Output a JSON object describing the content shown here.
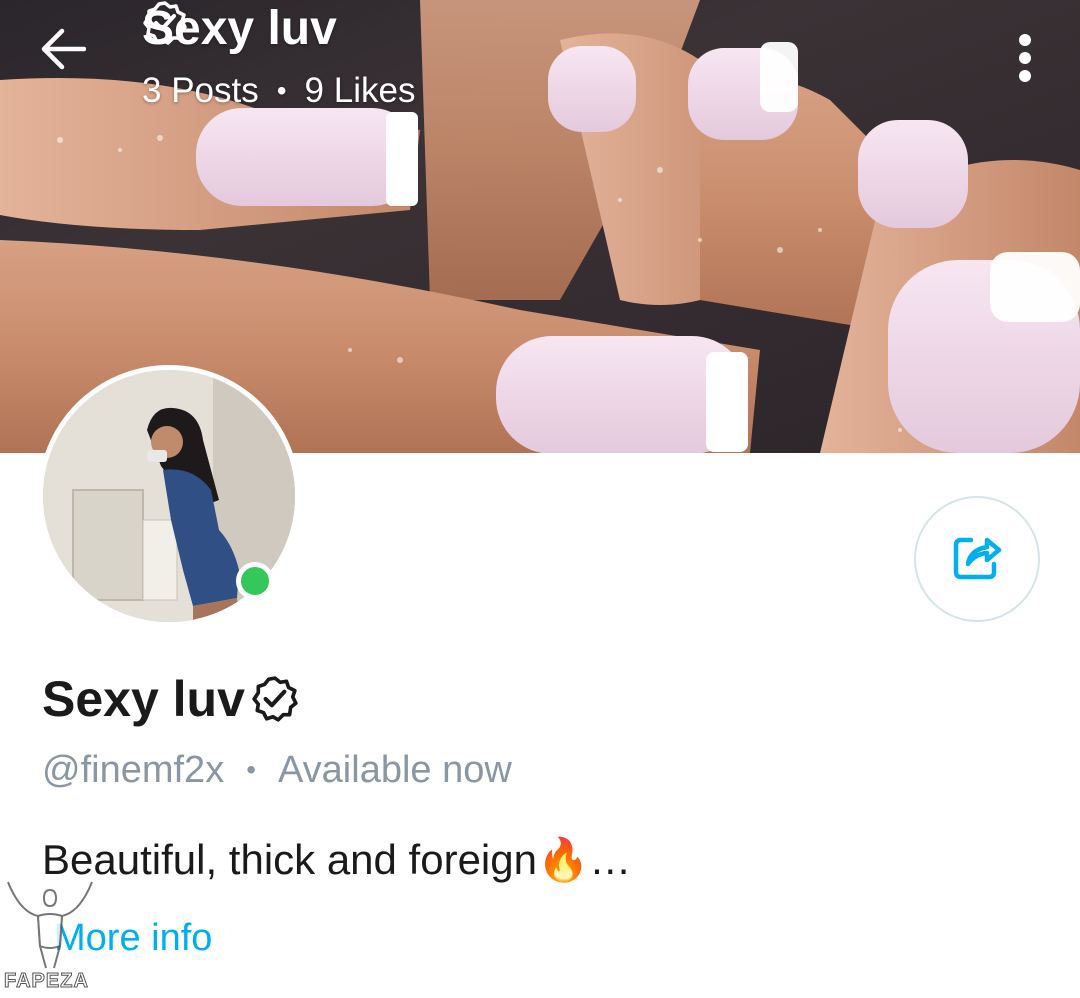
{
  "header": {
    "title": "Sexy luv",
    "posts": "3 Posts",
    "separator": "•",
    "likes": "9 Likes"
  },
  "icons": {
    "back": "arrow-left-icon",
    "more": "more-vertical-icon",
    "verified": "verified-badge-icon",
    "share": "share-icon"
  },
  "profile": {
    "name": "Sexy luv",
    "handle": "@finemf2x",
    "separator": "•",
    "status": "Available now",
    "online": true,
    "bio": "Beautiful, thick and foreign🔥…",
    "more_info": "More info"
  },
  "watermark": {
    "text": "FAPEZA"
  },
  "colors": {
    "accent": "#00aff0",
    "online": "#34c759",
    "muted_text": "#8a96a3",
    "text": "#1a1a1a"
  }
}
